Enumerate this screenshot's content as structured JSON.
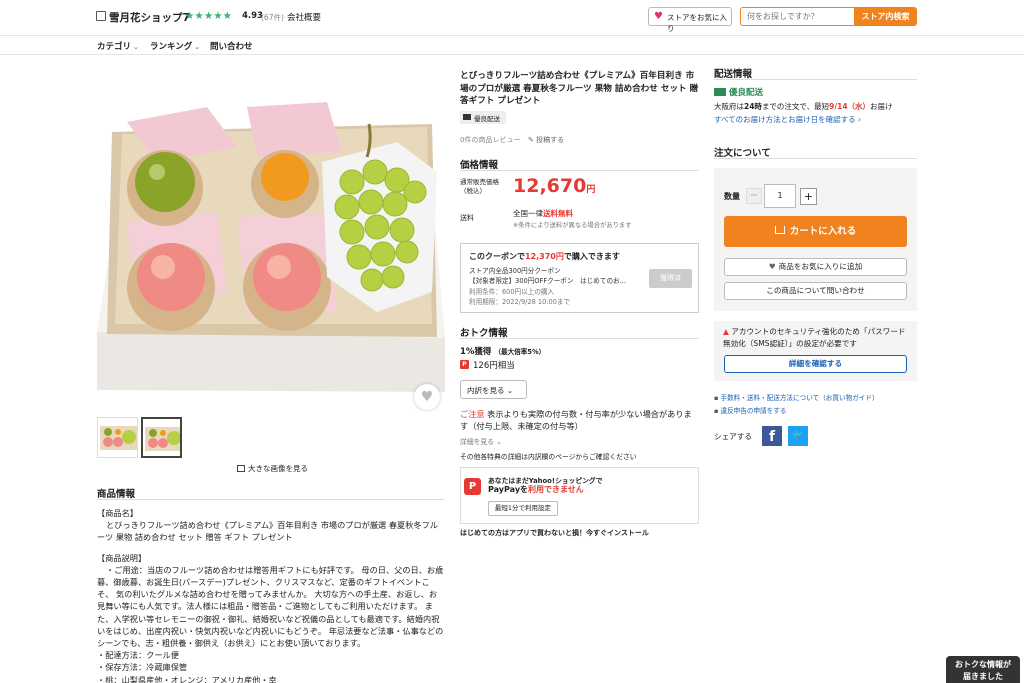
{
  "header": {
    "store_name": "雪月花ショップ7",
    "stars": "★★★★★",
    "rating": "4.93",
    "rating_count": "(67件)",
    "company": "会社概要",
    "fav_store": "ストアをお気に入り",
    "search_placeholder": "何をお探しですか？",
    "search_button": "ストア内検索"
  },
  "nav": {
    "category": "カテゴリ",
    "ranking": "ランキング",
    "contact": "問い合わせ"
  },
  "gallery": {
    "large_image_link": "大きな画像を見る"
  },
  "product_info": {
    "title": "商品情報",
    "name_header": "【商品名】",
    "name_text": "とびっきりフルーツ詰め合わせ《プレミアム》百年目利き 市場のプロが厳選 春夏秋冬フルーツ 果物 詰め合わせ セット 贈答 ギフト プレゼント",
    "desc_header": "【商品説明】",
    "desc_text": "・ご用途：当店のフルーツ詰め合わせは贈答用ギフトにも好評です。 母の日、父の日、お歳暮、御歳暮、お誕生日(バースデー)プレゼント、クリスマスなど、定番のギフトイベントこそ、 気の利いたグルメな詰め合わせを贈ってみませんか。 大切な方への手土産、お返し、お見舞い等にも人気です。法人様には粗品・贈答品・ご進物としてもご利用いただけます。 また、入学祝い等セレモニーの御祝・御礼、結婚祝いなど祝儀の品としても最適です。結婚内祝いをはじめ、出産内祝い・快気内祝いなど内祝いにもどうぞ。 年忌法要など法事・仏事などのシーンでも、志・粗供養・御供え（お供え）にとお使い頂いております。",
    "delivery": "・配達方法：クール便",
    "storage": "・保存方法：冷蔵庫保管",
    "origin": "・桃：山梨県産他・オレンジ：アメリカ産他・幸"
  },
  "product": {
    "title": "とびっきりフルーツ詰め合わせ《プレミアム》百年目利き 市場のプロが厳選 春夏秋冬フルーツ 果物 詰め合わせ セット 贈答ギフト プレゼント",
    "badge": "優良配送",
    "reviews": "0件の商品レビュー",
    "post_review": "投稿する"
  },
  "price": {
    "section": "価格情報",
    "label_line1": "通常販売価格",
    "label_line2": "（税込）",
    "amount": "12,670",
    "yen": "円",
    "ship_label": "送料",
    "ship_prefix": "全国一律",
    "ship_free": "送料無料",
    "ship_note": "※条件により送料が異なる場合があります"
  },
  "coupon": {
    "head_prefix": "このクーポンで",
    "head_price": "12,370円",
    "head_suffix": "で購入できます",
    "line1": "ストア内全品300円分クーポン",
    "line2": "【対象者限定】300円OFFクーポン　はじめてのお...",
    "line3": "利用条件：600円以上の購入",
    "line4": "利用期限：2022/9/28 10:00まで",
    "button": "獲得済"
  },
  "deals": {
    "section": "おトク情報",
    "pct": "1%獲得",
    "pct_note": "（最大倍率5%）",
    "paypay_icon": "P",
    "paypay_value": "126円相当",
    "breakdown": "内訳を見る",
    "caution_label": "ご注意",
    "caution_text": " 表示よりも実際の付与数・付与率が少ない場合があります（付与上限、未確定の付与等）",
    "detail_link": "詳細を見る",
    "other_note": "その他各特典の詳細は内訳欄のページからご確認ください"
  },
  "paypay": {
    "logo": "P",
    "line1": "あなたはまだYahoo!ショッピングで",
    "line2_prefix": "PayPayを",
    "line2_red": "利用できません",
    "button": "最短1分で利用設定",
    "app_promo": "はじめての方はアプリで買わないと損！今すぐインストール"
  },
  "shipping": {
    "section": "配送情報",
    "badge": "優良配送",
    "text_prefix": "大阪府は",
    "hours": "24時",
    "text_mid": "までの注文で、最短",
    "date": "9/14（水）",
    "text_suffix": "お届け",
    "link": "すべてのお届け方法とお届け日を確認する ›"
  },
  "order": {
    "section": "注文について",
    "qty_label": "数量",
    "qty_minus": "−",
    "qty_value": "1",
    "qty_plus": "+",
    "cart": "カートに入れる",
    "fav": "商品をお気に入りに追加",
    "inquiry": "この商品について問い合わせ"
  },
  "security": {
    "text": "アカウントのセキュリティ強化のため「パスワード無効化（SMS認証）」の設定が必要です",
    "button": "詳細を確認する"
  },
  "links": {
    "guide": "手数料・送料・配送方法について（お買い物ガイド）",
    "report": "違反申告の申請をする",
    "share": "シェアする"
  },
  "float_tab": {
    "line1": "おトクな情報が",
    "line2": "届きました"
  },
  "colors": {
    "accent_orange": "#f0831e",
    "price_red": "#e53934",
    "link_blue": "#1a5fb4",
    "star_green": "#3cb371"
  }
}
